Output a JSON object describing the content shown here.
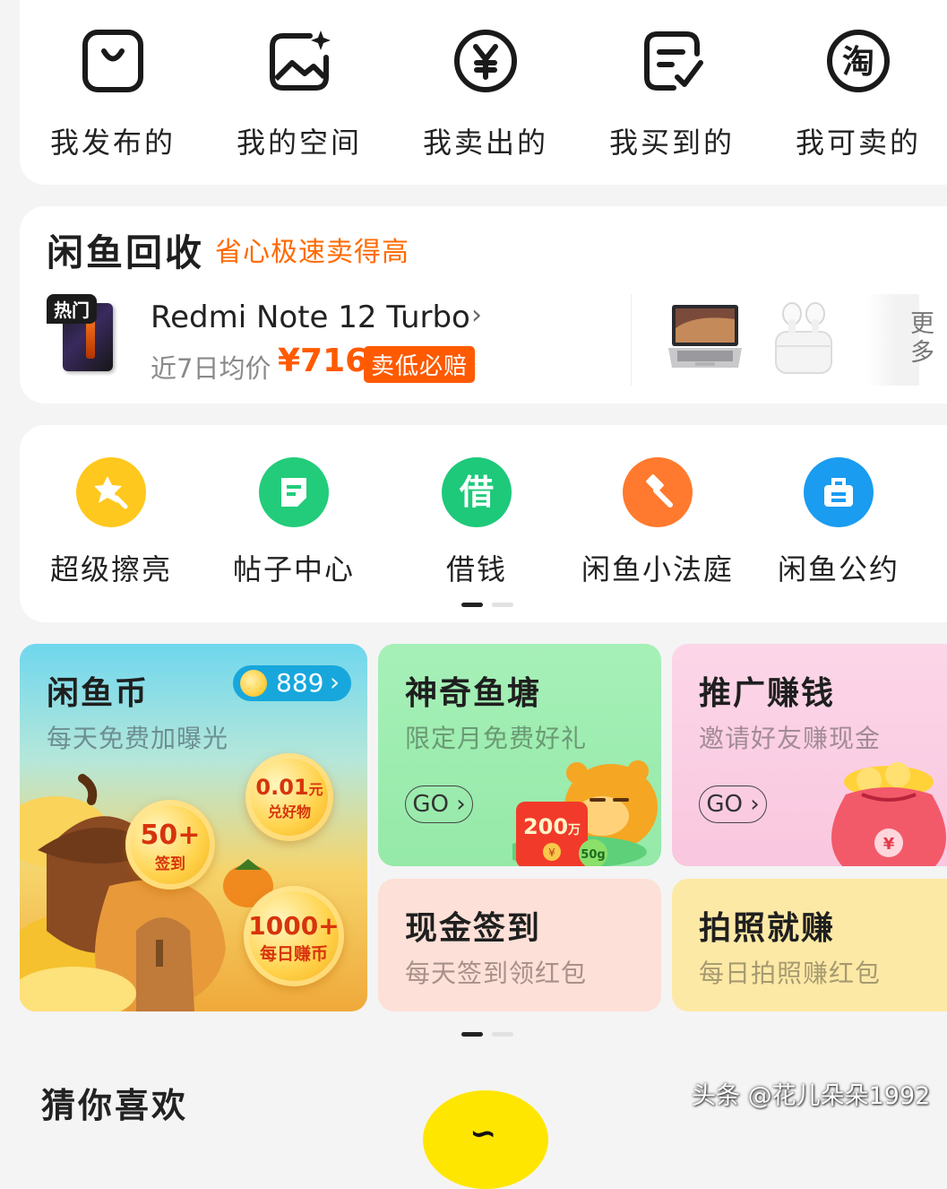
{
  "shortcuts": [
    {
      "label": "我发布的",
      "icon": "bag-icon"
    },
    {
      "label": "我的空间",
      "icon": "image-sparkle-icon"
    },
    {
      "label": "我卖出的",
      "icon": "yuan-circle-icon"
    },
    {
      "label": "我买到的",
      "icon": "order-check-icon"
    },
    {
      "label": "我可卖的",
      "icon": "taobao-icon"
    }
  ],
  "taobao_glyph": "淘",
  "recycle": {
    "title": "闲鱼回收",
    "slogan": "省心极速卖得高",
    "hot_badge": "热门",
    "product_name": "Redmi Note 12 Turbo",
    "arrow": "›",
    "avg_label": "近7日均价",
    "avg_price": "¥716",
    "guarantee": "卖低必赔",
    "more_label": "更多"
  },
  "tools": {
    "items": [
      {
        "label": "超级擦亮",
        "icon": "star-sparkle-icon",
        "color": "#ffc81e"
      },
      {
        "label": "帖子中心",
        "icon": "document-icon",
        "color": "#22cc7a"
      },
      {
        "label": "借钱",
        "icon": "borrow-icon",
        "color": "#1ec97a",
        "glyph": "借"
      },
      {
        "label": "闲鱼小法庭",
        "icon": "gavel-icon",
        "color": "#ff7a2e"
      },
      {
        "label": "闲鱼公约",
        "icon": "briefcase-icon",
        "color": "#1a9cf0"
      }
    ],
    "page_index": 1,
    "page_count": 2
  },
  "activities": {
    "coin": {
      "title": "闲鱼币",
      "subtitle": "每天免费加曝光",
      "count": "889",
      "chevron": "›",
      "medal_small_value": "0.01",
      "medal_small_unit": "元",
      "medal_small_label": "兑好物",
      "medal_signin_value": "50+",
      "medal_signin_label": "签到",
      "medal_daily_value": "1000+",
      "medal_daily_label": "每日赚币"
    },
    "pond": {
      "title": "神奇鱼塘",
      "subtitle": "限定月免费好礼",
      "go": "GO",
      "redpacket_value": "200",
      "redpacket_unit": "万",
      "weight": "50g",
      "currency_mark": "¥"
    },
    "promo": {
      "title": "推广赚钱",
      "subtitle": "邀请好友赚现金",
      "go": "GO",
      "currency_mark": "¥"
    },
    "cash": {
      "title": "现金签到",
      "subtitle": "每天签到领红包"
    },
    "photo": {
      "title": "拍照就赚",
      "subtitle": "每日拍照赚红包"
    },
    "page_index": 1,
    "page_count": 2
  },
  "guess": {
    "title": "猜你喜欢"
  },
  "watermark": "头条 @花儿朵朵1992",
  "colors": {
    "accent": "#ff5a00",
    "brand_yellow": "#ffe600"
  }
}
